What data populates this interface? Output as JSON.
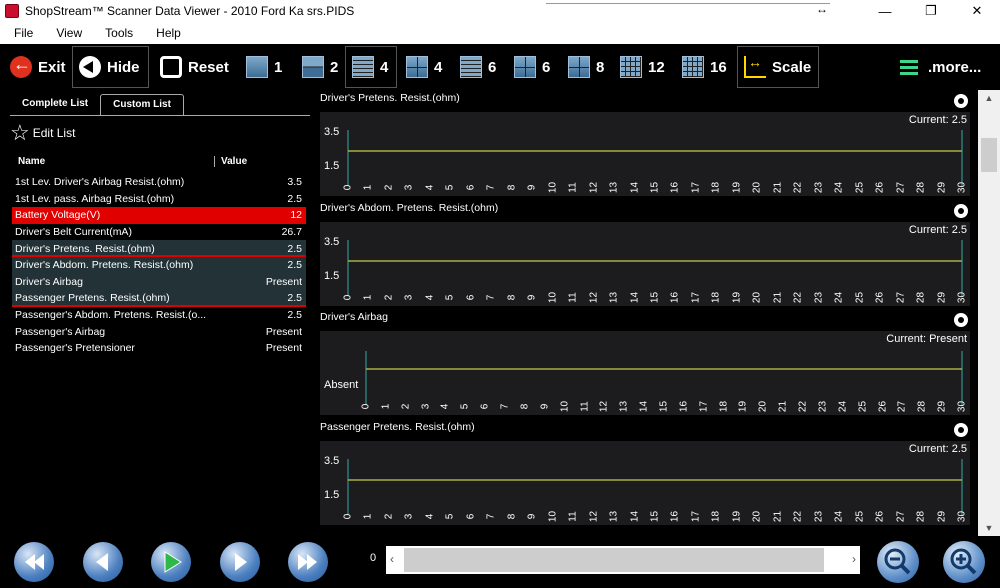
{
  "window": {
    "title": "ShopStream™ Scanner Data Viewer - 2010 Ford Ka srs.PIDS",
    "resize_glyph": "↔",
    "min": "—",
    "max": "❐",
    "close": "✕"
  },
  "menu": [
    "File",
    "View",
    "Tools",
    "Help"
  ],
  "toolbar": {
    "exit": "Exit",
    "hide": "Hide",
    "reset": "Reset",
    "layouts": [
      "1",
      "2",
      "4",
      "4",
      "6",
      "6",
      "8",
      "12",
      "16"
    ],
    "selected_layout": "4",
    "scale": "Scale",
    "more": ".more..."
  },
  "left": {
    "tabs": [
      "Complete List",
      "Custom List"
    ],
    "active_tab": "Custom List",
    "edit_list": "Edit List",
    "col_name": "Name",
    "col_value": "Value",
    "rows": [
      {
        "name": "1st Lev. Driver's Airbag Resist.(ohm)",
        "value": "3.5"
      },
      {
        "name": "1st Lev. pass. Airbag Resist.(ohm)",
        "value": "2.5"
      },
      {
        "name": "Battery Voltage(V)",
        "value": "12"
      },
      {
        "name": "Driver's Belt Current(mA)",
        "value": "26.7"
      },
      {
        "name": "Driver's Pretens. Resist.(ohm)",
        "value": "2.5"
      },
      {
        "name": "Driver's Abdom. Pretens. Resist.(ohm)",
        "value": "2.5"
      },
      {
        "name": "Driver's Airbag",
        "value": "Present"
      },
      {
        "name": "Passenger Pretens. Resist.(ohm)",
        "value": "2.5"
      },
      {
        "name": "Passenger's Abdom. Pretens. Resist.(o...",
        "value": "2.5"
      },
      {
        "name": "Passenger's Airbag",
        "value": "Present"
      },
      {
        "name": "Passenger's Pretensioner",
        "value": "Present"
      }
    ]
  },
  "graphs": [
    {
      "title": "Driver's Pretens. Resist.(ohm)",
      "current": "Current: 2.5",
      "y_labels": [
        "3.5",
        "1.5"
      ],
      "value": 2.5,
      "ylim": [
        1.5,
        3.5
      ]
    },
    {
      "title": "Driver's Abdom. Pretens. Resist.(ohm)",
      "current": "Current: 2.5",
      "y_labels": [
        "3.5",
        "1.5"
      ],
      "value": 2.5,
      "ylim": [
        1.5,
        3.5
      ]
    },
    {
      "title": "Driver's Airbag",
      "current": "Current: Present",
      "y_labels": [
        "Absent"
      ],
      "value": "Present"
    },
    {
      "title": "Passenger Pretens. Resist.(ohm)",
      "current": "Current: 2.5",
      "y_labels": [
        "3.5",
        "1.5"
      ],
      "value": 2.5,
      "ylim": [
        1.5,
        3.5
      ]
    }
  ],
  "x_ticks": [
    "0",
    "1",
    "2",
    "3",
    "4",
    "5",
    "6",
    "7",
    "8",
    "9",
    "10",
    "11",
    "12",
    "13",
    "14",
    "15",
    "16",
    "17",
    "18",
    "19",
    "20",
    "21",
    "22",
    "23",
    "24",
    "25",
    "26",
    "27",
    "28",
    "29",
    "30"
  ],
  "bottom": {
    "position": "0"
  },
  "colors": {
    "alarm": "#e00000",
    "trace": "#c8c84a",
    "selected_row": "#223236"
  }
}
